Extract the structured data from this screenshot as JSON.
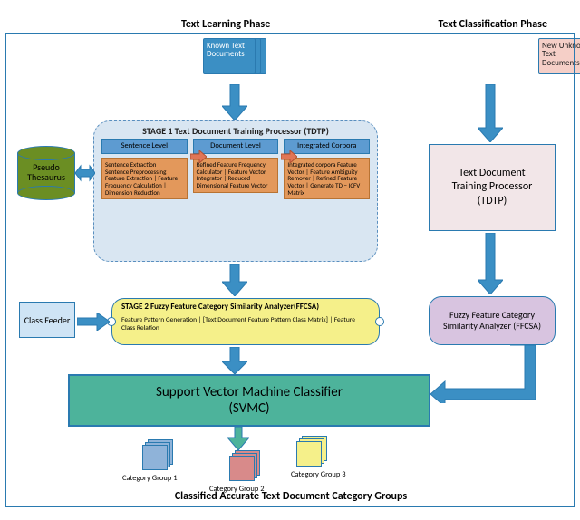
{
  "phases": {
    "learning": "Text Learning Phase",
    "classification": "Text Classification Phase"
  },
  "inputs": {
    "known": "Known Text Documents",
    "unknown": "New Unknown Text Documents"
  },
  "thesaurus": "Pseudo Thesaurus",
  "stage1": {
    "title": "STAGE 1 Text Document Training Processor (TDTP)",
    "cols": [
      {
        "header": "Sentence Level",
        "body": "Sentence Extraction | Sentence Preprocessing | Feature Extraction | Feature Frequency Calculation | Dimension Reduction"
      },
      {
        "header": "Document Level",
        "body": "Refined Feature Frequency Calculator | Feature Vector Integrator | Reduced Dimensional Feature Vector"
      },
      {
        "header": "Integrated Corpora",
        "body": "Integrated corpora Feature Vector | Feature Ambiguity Remover | Refined Feature Vector | Generate TD – ICFV Matrix"
      }
    ]
  },
  "feeder": "Class Feeder",
  "stage2": {
    "title": "STAGE 2 Fuzzy Feature Category Similarity Analyzer(FFCSA)",
    "body": "Feature Pattern Generation | [Text Document Feature Pattern Class Matrix] | Feature  Class Relation"
  },
  "tdtp": {
    "line1": "Text Document",
    "line2": "Training Processor",
    "line3": "(TDTP)"
  },
  "ffcsa": {
    "line1": "Fuzzy Feature Category",
    "line2": "Similarity Analyzer (FFCSA)"
  },
  "svmc": {
    "line1": "Support Vector Machine Classifier",
    "line2": "(SVMC)"
  },
  "categories": {
    "g1": "Category Group 1",
    "g2": "Category Group 2",
    "g3": "Category Group 3",
    "colors": {
      "g1": "#8fb3d9",
      "g2": "#d88a8a",
      "g3": "#f5f08a"
    }
  },
  "bottom": "Classified Accurate Text Document Category  Groups",
  "arrow_color": "#3b8fc4"
}
